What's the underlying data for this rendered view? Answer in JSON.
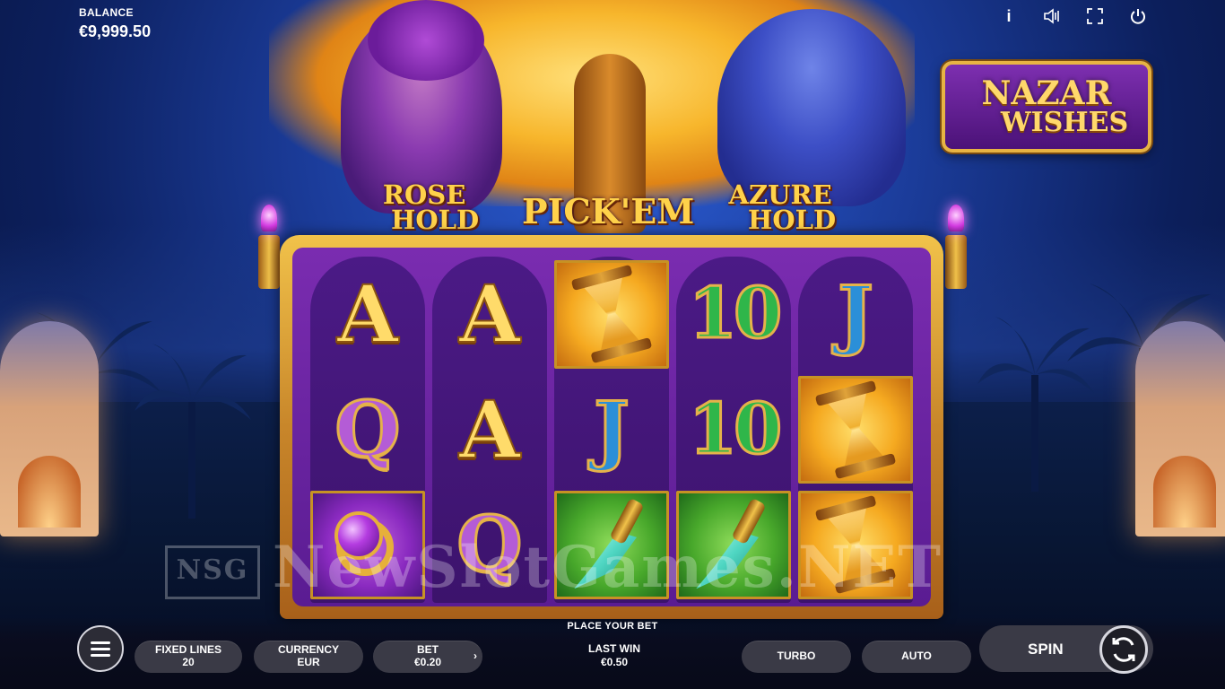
{
  "balance": {
    "label": "BALANCE",
    "value": "€9,999.50"
  },
  "top_icons": [
    "info-icon",
    "sound-icon",
    "fullscreen-icon",
    "power-icon"
  ],
  "logo": {
    "line1": "NAZAR",
    "line2": "WISHES"
  },
  "features": {
    "rose": {
      "line1": "ROSE",
      "line2": "HOLD"
    },
    "pick": "PICK'EM",
    "azure": {
      "line1": "AZURE",
      "line2": "HOLD"
    }
  },
  "reels": [
    [
      "A",
      "Q",
      "ring"
    ],
    [
      "A",
      "A",
      "Q"
    ],
    [
      "hourglass",
      "J",
      "dagger"
    ],
    [
      "10",
      "10",
      "dagger"
    ],
    [
      "J",
      "hourglass",
      "hourglass"
    ]
  ],
  "symbols": {
    "A": "A",
    "Q": "Q",
    "J": "J",
    "ten": "10"
  },
  "watermark": {
    "mark": "NSG",
    "text": "NewSlotGames.NET"
  },
  "status": "PLACE YOUR BET",
  "controls": {
    "fixed_lines": {
      "label": "FIXED LINES",
      "value": "20"
    },
    "currency": {
      "label": "CURRENCY",
      "value": "EUR"
    },
    "bet": {
      "label": "BET",
      "value": "€0.20",
      "arrow": "›"
    },
    "last_win": {
      "label": "LAST WIN",
      "value": "€0.50"
    },
    "turbo": "TURBO",
    "auto": "AUTO",
    "spin": "SPIN"
  },
  "colors": {
    "gold": "#f1c24a",
    "purple": "#5a1c92",
    "panel": "#3a3a46"
  }
}
